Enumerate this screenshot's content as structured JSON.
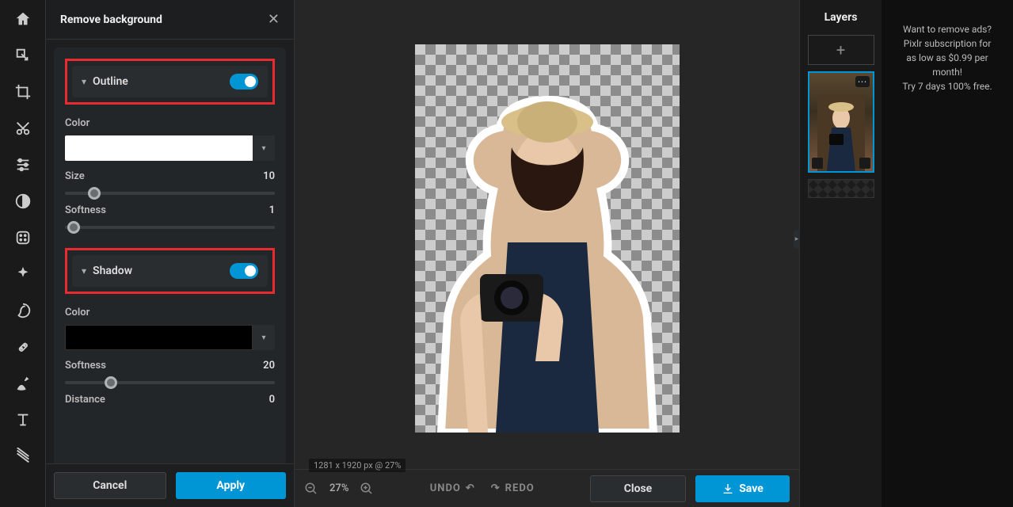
{
  "panel": {
    "title": "Remove background",
    "outline_label": "Outline",
    "outline_on": true,
    "color_label": "Color",
    "size_label": "Size",
    "size_value": "10",
    "size_pct": 14,
    "softness_label": "Softness",
    "softness_value": "1",
    "softness_pct": 4,
    "shadow_label": "Shadow",
    "shadow_on": true,
    "shadow_color_label": "Color",
    "shadow_softness_label": "Softness",
    "shadow_softness_value": "20",
    "shadow_softness_pct": 22,
    "distance_label": "Distance",
    "distance_value": "0",
    "cancel": "Cancel",
    "apply": "Apply"
  },
  "canvas": {
    "meta": "1281 x 1920 px @ 27%",
    "zoom": "27%"
  },
  "bottom": {
    "undo": "UNDO",
    "redo": "REDO",
    "close": "Close",
    "save": "Save"
  },
  "layers": {
    "title": "Layers"
  },
  "ad": {
    "line1": "Want to remove ads?",
    "line2": "Pixlr subscription for",
    "line3": "as low as $0.99 per",
    "line4": "month!",
    "line5": "Try 7 days 100% free."
  },
  "colors": {
    "accent": "#0096d6",
    "highlight": "#e82b2f"
  }
}
